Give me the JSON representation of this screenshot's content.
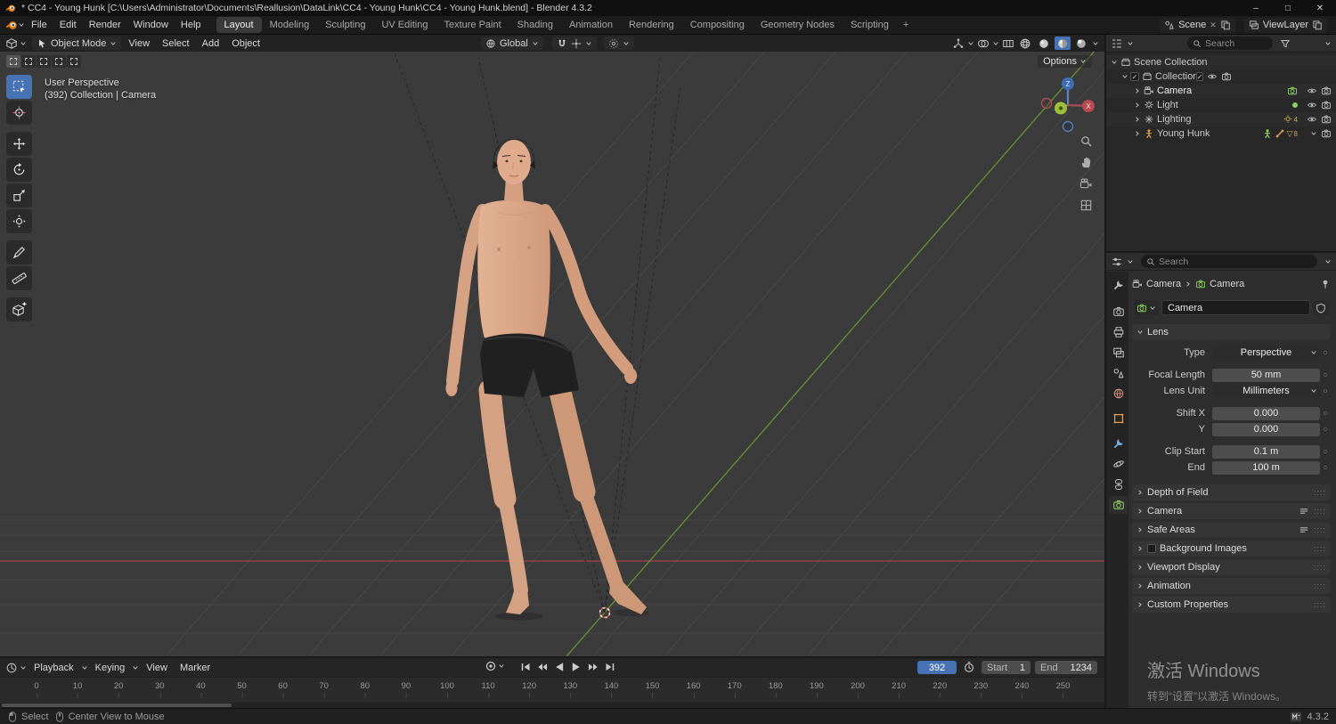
{
  "colors": {
    "accent": "#4772b3",
    "viewport_bg": "#3b3b3b",
    "panel_bg": "#2e2e2e",
    "axis_red": "#b5494e",
    "axis_green": "#6a9d2e",
    "skin": "#d9a286",
    "hair": "#241c18",
    "shorts": "#202020"
  },
  "titlebar": {
    "title": "* CC4 - Young Hunk [C:\\Users\\Administrator\\Documents\\Reallusion\\DataLink\\CC4 - Young Hunk\\CC4 - Young Hunk.blend] - Blender 4.3.2",
    "minimize": "–",
    "maximize": "□",
    "close": "✕"
  },
  "topbar": {
    "menus": [
      "File",
      "Edit",
      "Render",
      "Window",
      "Help"
    ],
    "workspaces": [
      "Layout",
      "Modeling",
      "Sculpting",
      "UV Editing",
      "Texture Paint",
      "Shading",
      "Animation",
      "Rendering",
      "Compositing",
      "Geometry Nodes",
      "Scripting"
    ],
    "add_workspace": "+",
    "scene_label": "Scene",
    "viewlayer_label": "ViewLayer"
  },
  "viewport": {
    "mode": "Object Mode",
    "menus": [
      "View",
      "Select",
      "Add",
      "Object"
    ],
    "orientation": "Global",
    "options_label": "Options",
    "overlay_line1": "User Perspective",
    "overlay_line2": "(392) Collection | Camera",
    "gizmo": {
      "x": "X",
      "y": "Y",
      "z": "Z"
    }
  },
  "outliner": {
    "search_placeholder": "Search",
    "rows": [
      {
        "label": "Scene Collection"
      },
      {
        "label": "Collection"
      },
      {
        "label": "Camera"
      },
      {
        "label": "Light"
      },
      {
        "label": "Lighting",
        "badge_count": "4"
      },
      {
        "label": "Young Hunk",
        "mesh_count": "8"
      }
    ]
  },
  "properties": {
    "search_placeholder": "Search",
    "breadcrumb": {
      "object": "Camera",
      "data": "Camera"
    },
    "name_field": "Camera",
    "lens": {
      "title": "Lens",
      "type_label": "Type",
      "type_value": "Perspective",
      "focal_label": "Focal Length",
      "focal_value": "50 mm",
      "unit_label": "Lens Unit",
      "unit_value": "Millimeters",
      "shiftx_label": "Shift X",
      "shiftx_value": "0.000",
      "shifty_label": "Y",
      "shifty_value": "0.000",
      "clipstart_label": "Clip Start",
      "clipstart_value": "0.1 m",
      "clipend_label": "End",
      "clipend_value": "100 m"
    },
    "sections": [
      "Depth of Field",
      "Camera",
      "Safe Areas",
      "Background Images",
      "Viewport Display",
      "Animation",
      "Custom Properties"
    ]
  },
  "timeline": {
    "menus": [
      "Playback",
      "Keying",
      "View",
      "Marker"
    ],
    "current_frame": "392",
    "start_label": "Start",
    "start_value": "1",
    "end_label": "End",
    "end_value": "1234",
    "ruler_ticks": [
      "0",
      "10",
      "20",
      "30",
      "40",
      "50",
      "60",
      "70",
      "80",
      "90",
      "100",
      "110",
      "120",
      "130",
      "140",
      "150",
      "160",
      "170",
      "180",
      "190",
      "200",
      "210",
      "220",
      "230",
      "240",
      "250"
    ]
  },
  "statusbar": {
    "select_label": "Select",
    "center_label": "Center View to Mouse",
    "version": "4.3.2"
  },
  "watermark": {
    "line1": "激活 Windows",
    "line2": "转到“设置”以激活 Windows。"
  }
}
